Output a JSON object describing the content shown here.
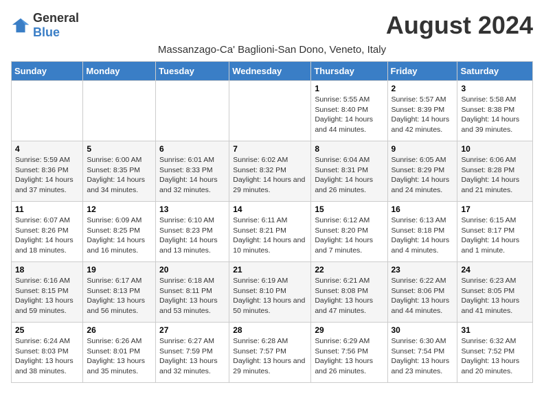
{
  "header": {
    "logo_general": "General",
    "logo_blue": "Blue",
    "month_title": "August 2024",
    "subtitle": "Massanzago-Ca' Baglioni-San Dono, Veneto, Italy"
  },
  "days_of_week": [
    "Sunday",
    "Monday",
    "Tuesday",
    "Wednesday",
    "Thursday",
    "Friday",
    "Saturday"
  ],
  "weeks": [
    [
      {
        "day": "",
        "info": ""
      },
      {
        "day": "",
        "info": ""
      },
      {
        "day": "",
        "info": ""
      },
      {
        "day": "",
        "info": ""
      },
      {
        "day": "1",
        "info": "Sunrise: 5:55 AM\nSunset: 8:40 PM\nDaylight: 14 hours and 44 minutes."
      },
      {
        "day": "2",
        "info": "Sunrise: 5:57 AM\nSunset: 8:39 PM\nDaylight: 14 hours and 42 minutes."
      },
      {
        "day": "3",
        "info": "Sunrise: 5:58 AM\nSunset: 8:38 PM\nDaylight: 14 hours and 39 minutes."
      }
    ],
    [
      {
        "day": "4",
        "info": "Sunrise: 5:59 AM\nSunset: 8:36 PM\nDaylight: 14 hours and 37 minutes."
      },
      {
        "day": "5",
        "info": "Sunrise: 6:00 AM\nSunset: 8:35 PM\nDaylight: 14 hours and 34 minutes."
      },
      {
        "day": "6",
        "info": "Sunrise: 6:01 AM\nSunset: 8:33 PM\nDaylight: 14 hours and 32 minutes."
      },
      {
        "day": "7",
        "info": "Sunrise: 6:02 AM\nSunset: 8:32 PM\nDaylight: 14 hours and 29 minutes."
      },
      {
        "day": "8",
        "info": "Sunrise: 6:04 AM\nSunset: 8:31 PM\nDaylight: 14 hours and 26 minutes."
      },
      {
        "day": "9",
        "info": "Sunrise: 6:05 AM\nSunset: 8:29 PM\nDaylight: 14 hours and 24 minutes."
      },
      {
        "day": "10",
        "info": "Sunrise: 6:06 AM\nSunset: 8:28 PM\nDaylight: 14 hours and 21 minutes."
      }
    ],
    [
      {
        "day": "11",
        "info": "Sunrise: 6:07 AM\nSunset: 8:26 PM\nDaylight: 14 hours and 18 minutes."
      },
      {
        "day": "12",
        "info": "Sunrise: 6:09 AM\nSunset: 8:25 PM\nDaylight: 14 hours and 16 minutes."
      },
      {
        "day": "13",
        "info": "Sunrise: 6:10 AM\nSunset: 8:23 PM\nDaylight: 14 hours and 13 minutes."
      },
      {
        "day": "14",
        "info": "Sunrise: 6:11 AM\nSunset: 8:21 PM\nDaylight: 14 hours and 10 minutes."
      },
      {
        "day": "15",
        "info": "Sunrise: 6:12 AM\nSunset: 8:20 PM\nDaylight: 14 hours and 7 minutes."
      },
      {
        "day": "16",
        "info": "Sunrise: 6:13 AM\nSunset: 8:18 PM\nDaylight: 14 hours and 4 minutes."
      },
      {
        "day": "17",
        "info": "Sunrise: 6:15 AM\nSunset: 8:17 PM\nDaylight: 14 hours and 1 minute."
      }
    ],
    [
      {
        "day": "18",
        "info": "Sunrise: 6:16 AM\nSunset: 8:15 PM\nDaylight: 13 hours and 59 minutes."
      },
      {
        "day": "19",
        "info": "Sunrise: 6:17 AM\nSunset: 8:13 PM\nDaylight: 13 hours and 56 minutes."
      },
      {
        "day": "20",
        "info": "Sunrise: 6:18 AM\nSunset: 8:11 PM\nDaylight: 13 hours and 53 minutes."
      },
      {
        "day": "21",
        "info": "Sunrise: 6:19 AM\nSunset: 8:10 PM\nDaylight: 13 hours and 50 minutes."
      },
      {
        "day": "22",
        "info": "Sunrise: 6:21 AM\nSunset: 8:08 PM\nDaylight: 13 hours and 47 minutes."
      },
      {
        "day": "23",
        "info": "Sunrise: 6:22 AM\nSunset: 8:06 PM\nDaylight: 13 hours and 44 minutes."
      },
      {
        "day": "24",
        "info": "Sunrise: 6:23 AM\nSunset: 8:05 PM\nDaylight: 13 hours and 41 minutes."
      }
    ],
    [
      {
        "day": "25",
        "info": "Sunrise: 6:24 AM\nSunset: 8:03 PM\nDaylight: 13 hours and 38 minutes."
      },
      {
        "day": "26",
        "info": "Sunrise: 6:26 AM\nSunset: 8:01 PM\nDaylight: 13 hours and 35 minutes."
      },
      {
        "day": "27",
        "info": "Sunrise: 6:27 AM\nSunset: 7:59 PM\nDaylight: 13 hours and 32 minutes."
      },
      {
        "day": "28",
        "info": "Sunrise: 6:28 AM\nSunset: 7:57 PM\nDaylight: 13 hours and 29 minutes."
      },
      {
        "day": "29",
        "info": "Sunrise: 6:29 AM\nSunset: 7:56 PM\nDaylight: 13 hours and 26 minutes."
      },
      {
        "day": "30",
        "info": "Sunrise: 6:30 AM\nSunset: 7:54 PM\nDaylight: 13 hours and 23 minutes."
      },
      {
        "day": "31",
        "info": "Sunrise: 6:32 AM\nSunset: 7:52 PM\nDaylight: 13 hours and 20 minutes."
      }
    ]
  ]
}
